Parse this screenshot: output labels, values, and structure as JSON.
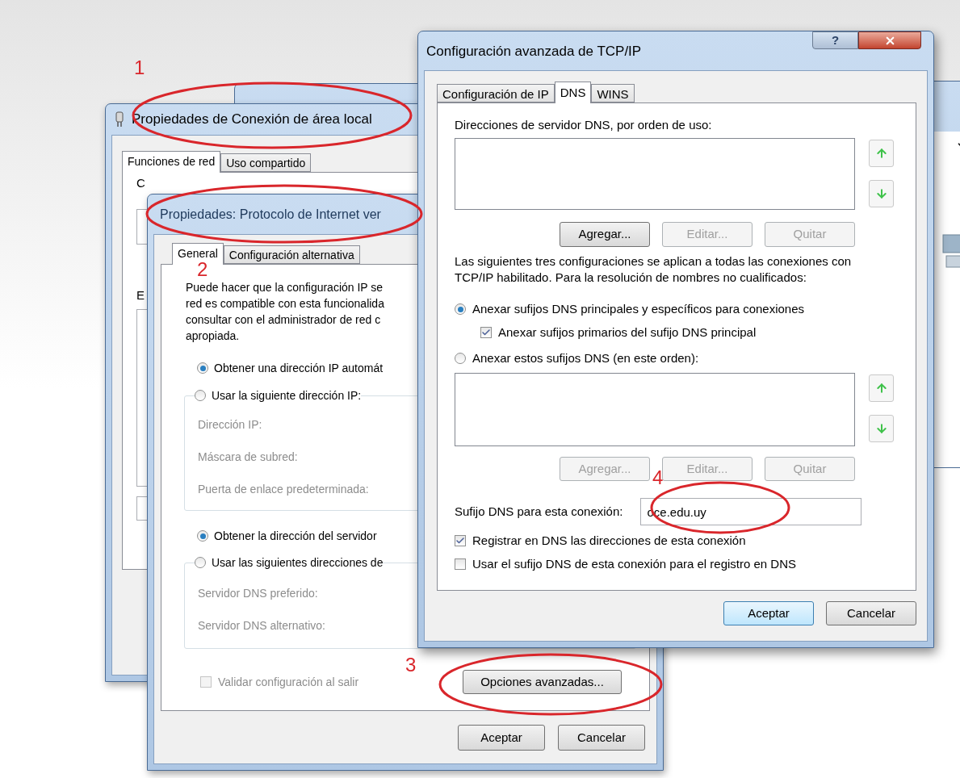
{
  "local_window": {
    "title": "Propiedades de Conexión de área local",
    "tabs": [
      {
        "label": "Funciones de red",
        "selected": true
      },
      {
        "label": "Uso compartido",
        "selected": false
      }
    ],
    "fragments": [
      "C",
      "E"
    ]
  },
  "ipv4_window": {
    "title": "Propiedades: Protocolo de Internet ver",
    "tabs": [
      {
        "label": "General",
        "selected": true
      },
      {
        "label": "Configuración alternativa",
        "selected": false
      }
    ],
    "description": "Puede hacer que la configuración IP se\nred es compatible con esta funcionalida\nconsultar con el administrador de red c\napropiada.",
    "ip_options": [
      {
        "label": "Obtener una dirección IP automát",
        "selected": true
      },
      {
        "label": "Usar la siguiente dirección IP:",
        "selected": false
      }
    ],
    "ip_fields": [
      {
        "label": "Dirección IP:",
        "disabled": true
      },
      {
        "label": "Máscara de subred:",
        "disabled": true
      },
      {
        "label": "Puerta de enlace predeterminada:",
        "disabled": true
      }
    ],
    "dns_options": [
      {
        "label": "Obtener la dirección del servidor",
        "selected": true
      },
      {
        "label": "Usar las siguientes direcciones de",
        "selected": false
      }
    ],
    "dns_fields": [
      {
        "label": "Servidor DNS preferido:",
        "disabled": true
      },
      {
        "label": "Servidor DNS alternativo:",
        "disabled": true
      }
    ],
    "validate": {
      "label": "Validar configuración al salir",
      "checked": false,
      "disabled": true
    },
    "advanced_button": "Opciones avanzadas...",
    "buttons": [
      "Aceptar",
      "Cancelar"
    ]
  },
  "advanced_dialog": {
    "title": "Configuración avanzada de TCP/IP",
    "help_button": "?",
    "tabs": [
      {
        "label": "Configuración de IP",
        "selected": false
      },
      {
        "label": "DNS",
        "selected": true
      },
      {
        "label": "WINS",
        "selected": false
      }
    ],
    "dns_servers": {
      "label": "Direcciones de servidor DNS, por orden de uso:",
      "buttons": [
        {
          "label": "Agregar...",
          "disabled": false
        },
        {
          "label": "Editar...",
          "disabled": true
        },
        {
          "label": "Quitar",
          "disabled": true
        }
      ]
    },
    "note": "Las siguientes tres configuraciones se aplican a todas las conexiones con\nTCP/IP habilitado. Para la resolución de nombres no cualificados:",
    "suffix_options": [
      {
        "label": "Anexar sufijos DNS principales y específicos para conexiones",
        "selected": true
      },
      {
        "label": "Anexar estos sufijos DNS (en este orden):",
        "selected": false
      }
    ],
    "primary_suffix": {
      "label": "Anexar sufijos primarios del sufijo DNS principal",
      "checked": true
    },
    "suffix_list": {
      "buttons": [
        {
          "label": "Agregar...",
          "disabled": true
        },
        {
          "label": "Editar...",
          "disabled": true
        },
        {
          "label": "Quitar",
          "disabled": true
        }
      ]
    },
    "connection_suffix": {
      "label": "Sufijo DNS para esta conexión:",
      "value": "oce.edu.uy"
    },
    "checks": [
      {
        "label": "Registrar en DNS las direcciones de esta conexión",
        "checked": true
      },
      {
        "label": "Usar el sufijo DNS de esta conexión para el registro en DNS",
        "checked": false
      }
    ],
    "buttons": [
      {
        "label": "Aceptar",
        "default": true
      },
      {
        "label": "Cancelar",
        "default": false
      }
    ]
  },
  "annotations": [
    {
      "label": "1"
    },
    {
      "label": "2"
    },
    {
      "label": "3"
    },
    {
      "label": "4"
    }
  ]
}
